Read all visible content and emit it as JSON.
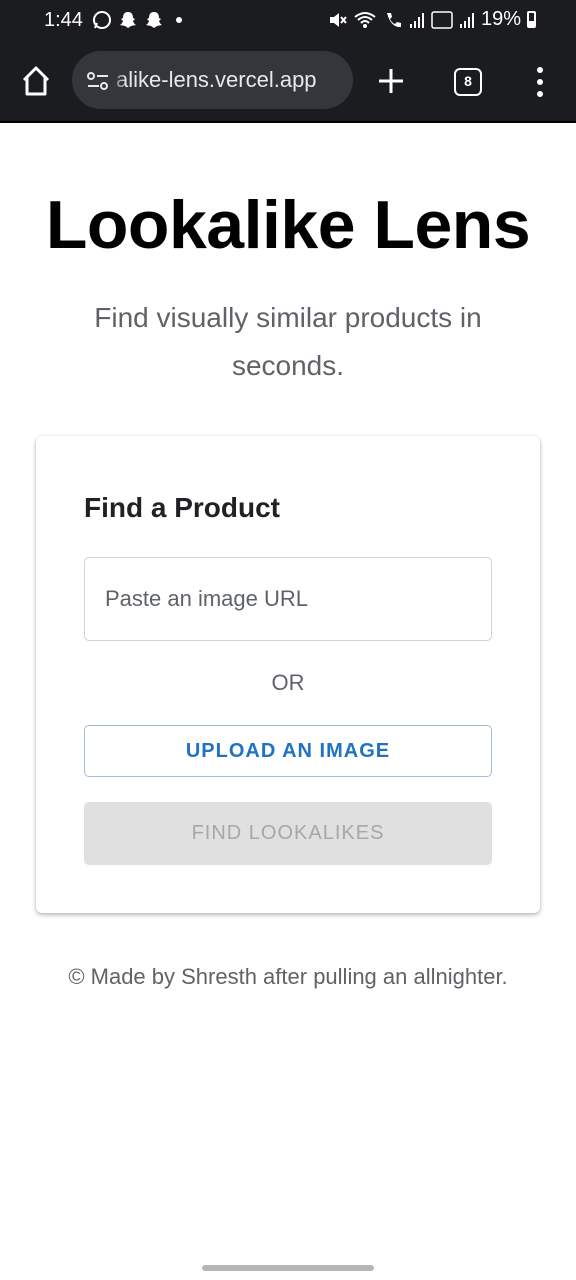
{
  "status_bar": {
    "time": "1:44",
    "battery": "19%"
  },
  "browser": {
    "url": "alike-lens.vercel.app",
    "tab_count": "8"
  },
  "page": {
    "title": "Lookalike Lens",
    "subtitle": "Find visually similar products in seconds."
  },
  "card": {
    "title": "Find a Product",
    "url_placeholder": "Paste an image URL",
    "or_label": "OR",
    "upload_label": "UPLOAD AN IMAGE",
    "find_label": "FIND LOOKALIKES"
  },
  "footer": {
    "text": "© Made by Shresth after pulling an allnighter."
  },
  "colors": {
    "status_bg": "#1b1c20",
    "url_pill_bg": "#34363b",
    "upload_text": "#1f73c2",
    "find_disabled_bg": "#e0e0e0"
  }
}
